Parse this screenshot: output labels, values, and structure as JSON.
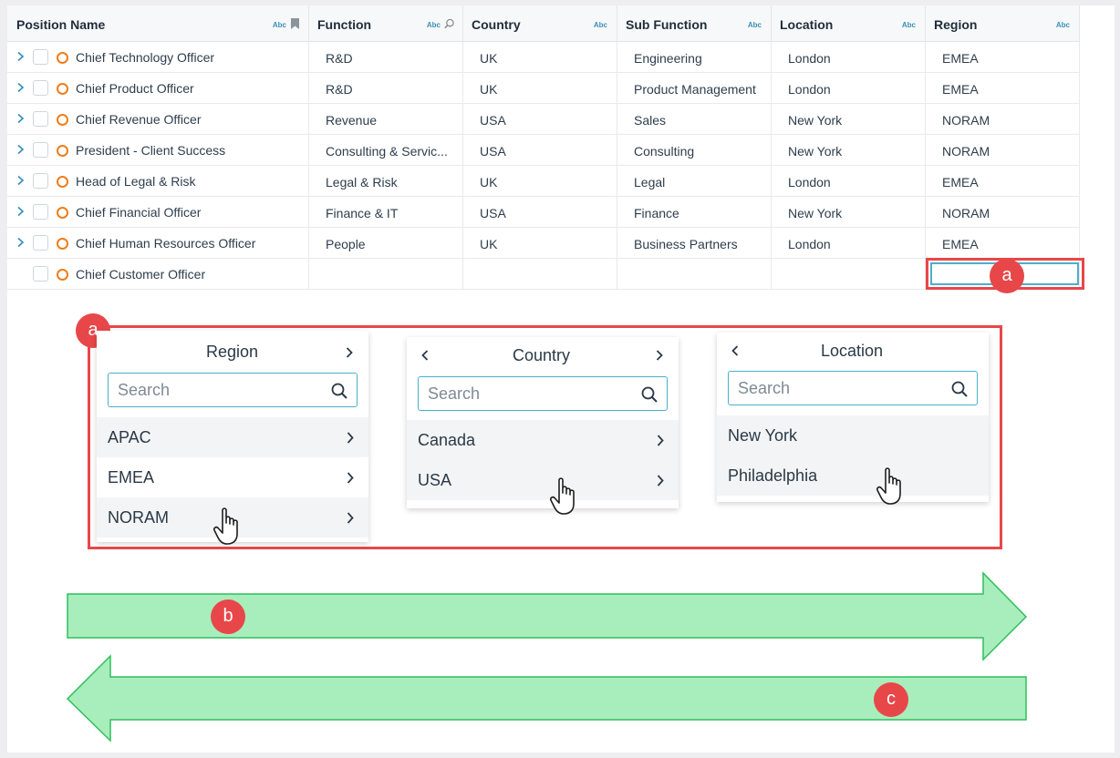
{
  "table": {
    "headers": [
      {
        "label": "Position Name",
        "type": "Abc",
        "icon": "bookmark-icon"
      },
      {
        "label": "Function",
        "type": "Abc",
        "icon": "zoom-icon"
      },
      {
        "label": "Country",
        "type": "Abc"
      },
      {
        "label": "Sub Function",
        "type": "Abc"
      },
      {
        "label": "Location",
        "type": "Abc"
      },
      {
        "label": "Region",
        "type": "Abc"
      }
    ],
    "rows": [
      {
        "name": "Chief Technology Officer",
        "function": "R&D",
        "country": "UK",
        "sub_function": "Engineering",
        "location": "London",
        "region": "EMEA"
      },
      {
        "name": "Chief Product Officer",
        "function": "R&D",
        "country": "UK",
        "sub_function": "Product Management",
        "location": "London",
        "region": "EMEA"
      },
      {
        "name": "Chief Revenue Officer",
        "function": "Revenue",
        "country": "USA",
        "sub_function": "Sales",
        "location": "New York",
        "region": "NORAM"
      },
      {
        "name": "President -  Client Success",
        "function": "Consulting & Servic...",
        "country": "USA",
        "sub_function": "Consulting",
        "location": "New York",
        "region": "NORAM"
      },
      {
        "name": "Head of Legal & Risk",
        "function": "Legal & Risk",
        "country": "UK",
        "sub_function": "Legal",
        "location": "London",
        "region": "EMEA"
      },
      {
        "name": "Chief Financial Officer",
        "function": "Finance & IT",
        "country": "USA",
        "sub_function": "Finance",
        "location": "New York",
        "region": "NORAM"
      },
      {
        "name": "Chief Human Resources Officer",
        "function": "People",
        "country": "UK",
        "sub_function": "Business Partners",
        "location": "London",
        "region": "EMEA"
      },
      {
        "name": "Chief Customer Officer",
        "function": "",
        "country": "",
        "sub_function": "",
        "location": "",
        "region": ""
      }
    ]
  },
  "badges": {
    "a_top": "a",
    "a_panels": "a",
    "b": "b",
    "c": "c"
  },
  "panels": {
    "region": {
      "title": "Region",
      "search_placeholder": "Search",
      "items": [
        "APAC",
        "EMEA",
        "NORAM"
      ]
    },
    "country": {
      "title": "Country",
      "search_placeholder": "Search",
      "items": [
        "Canada",
        "USA"
      ]
    },
    "location": {
      "title": "Location",
      "search_placeholder": "Search",
      "items": [
        "New York",
        "Philadelphia"
      ]
    }
  },
  "colors": {
    "accent": "#4ab0c8",
    "annotation": "#e8474a",
    "arrow_fill": "#a8eebc",
    "arrow_stroke": "#2fbf5b",
    "status_ring": "#ef7d1a"
  }
}
